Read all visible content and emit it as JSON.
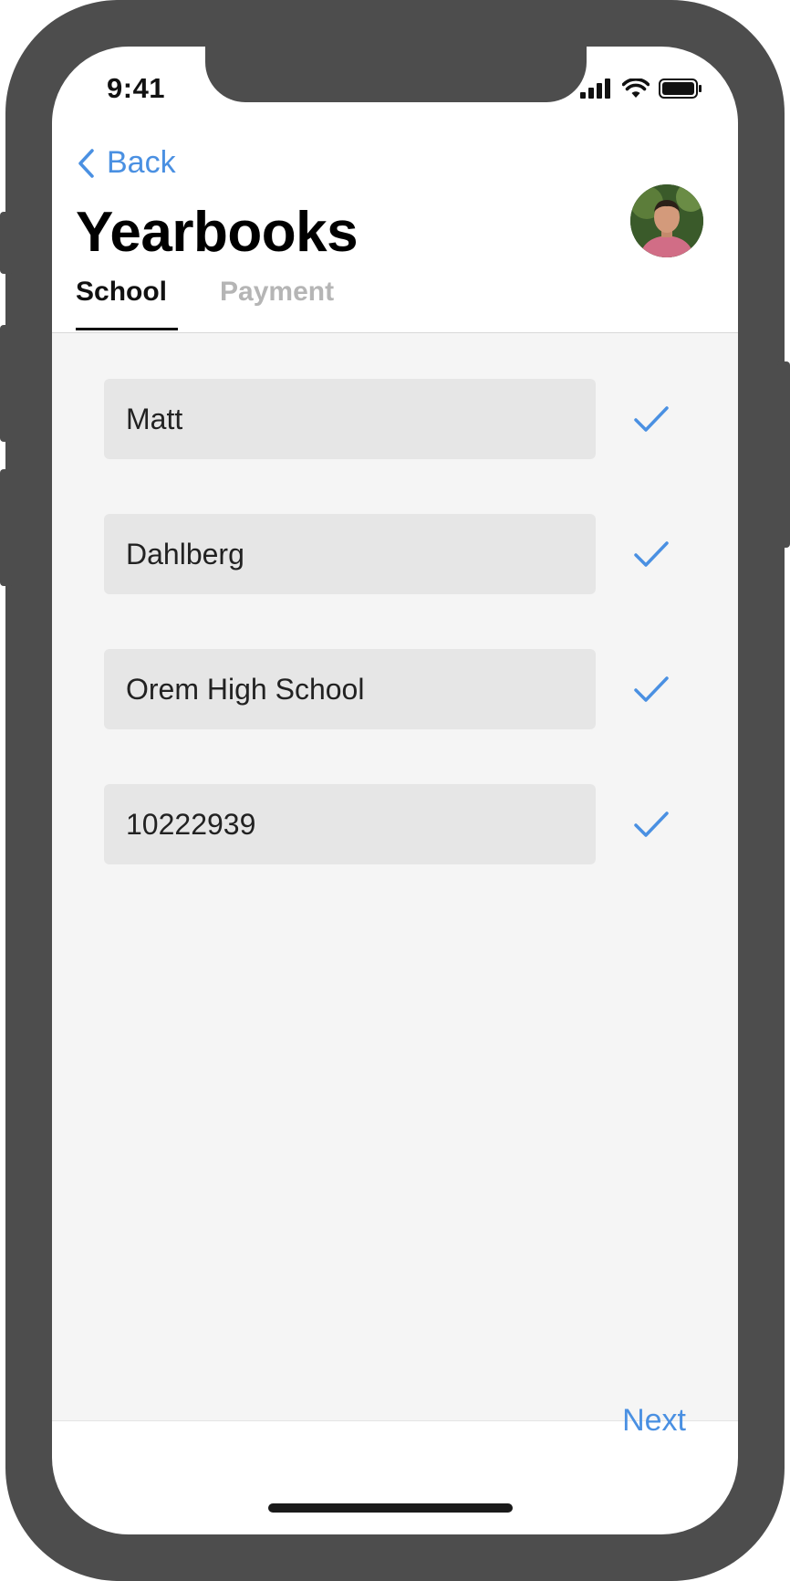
{
  "status_bar": {
    "time": "9:41",
    "icons": [
      "cellular-signal-icon",
      "wifi-icon",
      "battery-icon"
    ]
  },
  "nav": {
    "back_label": "Back",
    "title": "Yearbooks",
    "avatar": "profile-photo"
  },
  "tabs": [
    {
      "label": "School",
      "active": true
    },
    {
      "label": "Payment",
      "active": false
    }
  ],
  "form": {
    "fields": [
      {
        "value": "Matt",
        "validated": true
      },
      {
        "value": "Dahlberg",
        "validated": true
      },
      {
        "value": "Orem High School",
        "validated": true
      },
      {
        "value": "10222939",
        "validated": true
      }
    ]
  },
  "footer": {
    "next_label": "Next"
  },
  "colors": {
    "accent": "#4a90e2",
    "field_bg": "#e6e6e6",
    "content_bg": "#f5f5f5",
    "device_frame": "#4d4d4d",
    "inactive_tab": "#b5b5b5"
  }
}
